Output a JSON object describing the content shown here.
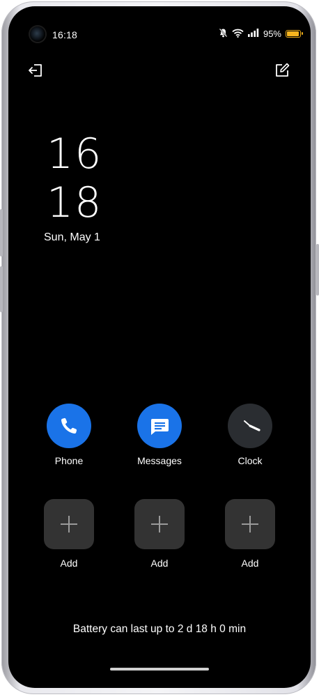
{
  "status_bar": {
    "time": "16:18",
    "battery_percent": "95%",
    "battery_level": 0.95,
    "icons": [
      "silent-bell-icon",
      "wifi-icon",
      "signal-icon",
      "battery-icon"
    ]
  },
  "toolbar": {
    "left_icon": "exit-icon",
    "right_icon": "edit-icon"
  },
  "clock": {
    "hours": "16",
    "minutes": "18",
    "date": "Sun, May 1"
  },
  "apps": [
    {
      "label": "Phone",
      "icon": "phone-icon",
      "color": "#1a73e8"
    },
    {
      "label": "Messages",
      "icon": "messages-icon",
      "color": "#1a73e8"
    },
    {
      "label": "Clock",
      "icon": "clock-icon",
      "color": "#2a2d31"
    }
  ],
  "add_slots": [
    {
      "label": "Add",
      "icon": "plus-icon"
    },
    {
      "label": "Add",
      "icon": "plus-icon"
    },
    {
      "label": "Add",
      "icon": "plus-icon"
    }
  ],
  "footer": {
    "battery_estimate": "Battery can last up to 2 d 18 h 0 min"
  }
}
